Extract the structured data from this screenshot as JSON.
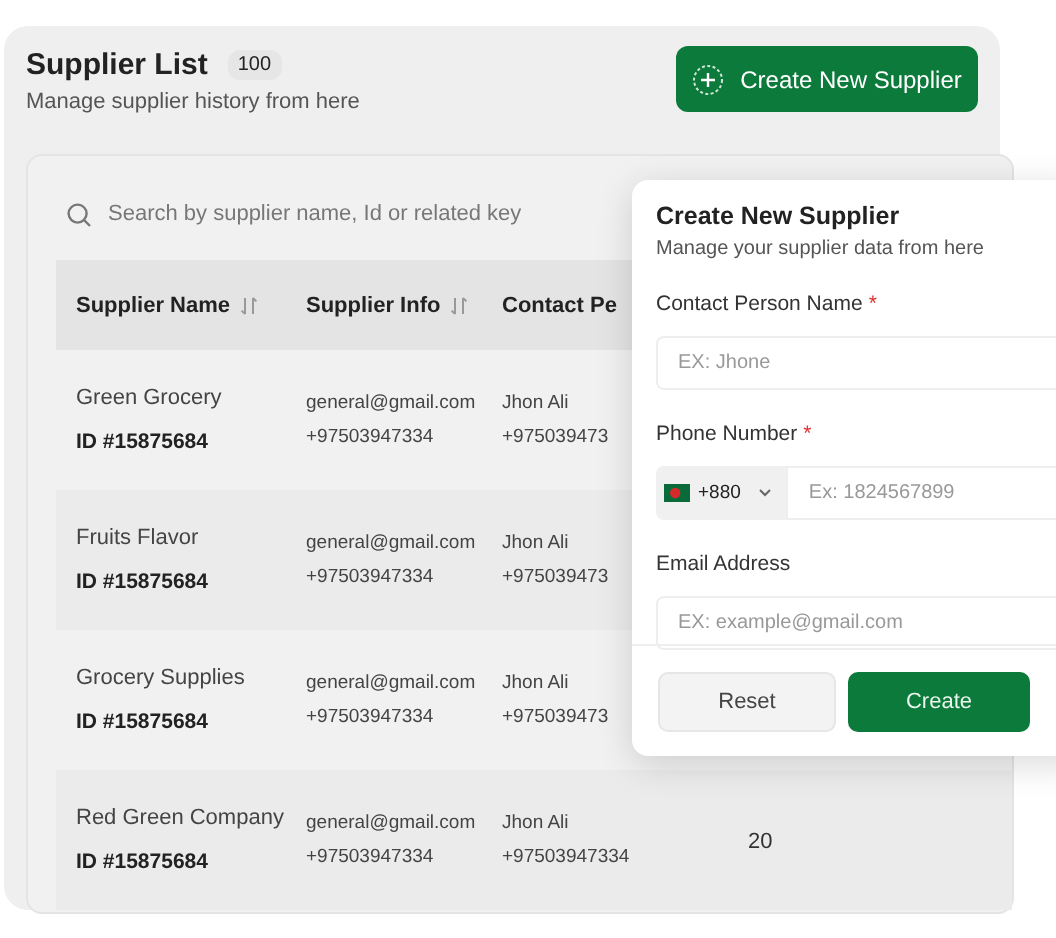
{
  "header": {
    "title": "Supplier List",
    "count": "100",
    "subtitle": "Manage supplier history from here",
    "create_button": "Create New Supplier"
  },
  "search": {
    "placeholder": "Search by supplier name, Id or related key"
  },
  "table": {
    "columns": [
      {
        "label": "Supplier Name",
        "sortable": true
      },
      {
        "label": "Supplier Info",
        "sortable": true
      },
      {
        "label": "Contact Pe",
        "sortable": false
      }
    ],
    "rows": [
      {
        "name": "Green Grocery",
        "id": "ID #15875684",
        "email": "general@gmail.com",
        "phone": "+97503947334",
        "contact": "Jhon Ali",
        "contact_phone": "+975039473"
      },
      {
        "name": "Fruits Flavor",
        "id": "ID #15875684",
        "email": "general@gmail.com",
        "phone": "+97503947334",
        "contact": "Jhon Ali",
        "contact_phone": "+975039473"
      },
      {
        "name": "Grocery Supplies",
        "id": "ID #15875684",
        "email": "general@gmail.com",
        "phone": "+97503947334",
        "contact": "Jhon Ali",
        "contact_phone": "+975039473"
      },
      {
        "name": "Red Green Company",
        "id": "ID #15875684",
        "email": "general@gmail.com",
        "phone": "+97503947334",
        "contact": "Jhon Ali",
        "contact_phone": "+97503947334",
        "column_4": "20"
      }
    ]
  },
  "popover": {
    "title": "Create New Supplier",
    "subtitle": "Manage your supplier data from here",
    "fields": [
      {
        "kind": "text",
        "label": "Contact Person Name",
        "required_mark": "*",
        "placeholder": "EX: Jhone"
      },
      {
        "kind": "phone",
        "label": "Phone Number",
        "required_mark": "*",
        "country_code": "+880",
        "placeholder": "Ex: 1824567899"
      },
      {
        "kind": "text",
        "label": "Email Address",
        "placeholder": "EX: example@gmail.com"
      }
    ],
    "buttons": [
      {
        "label": "Reset",
        "kind": "secondary"
      },
      {
        "label": "Create",
        "kind": "primary"
      }
    ]
  }
}
